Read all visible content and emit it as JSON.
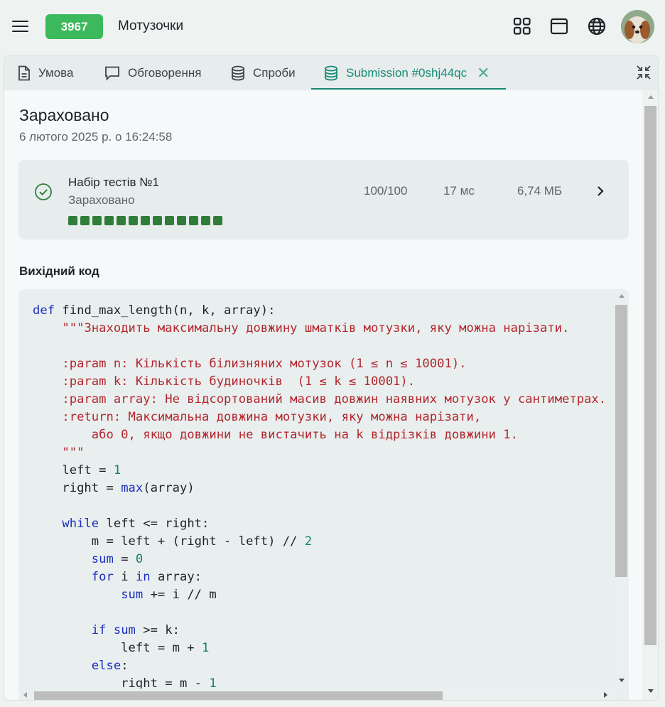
{
  "header": {
    "badge": "3967",
    "title": "Мотузочки",
    "icons": [
      "menu-icon",
      "apps-grid-icon",
      "window-icon",
      "globe-icon",
      "avatar"
    ]
  },
  "tabs": [
    {
      "label": "Умова",
      "icon": "document-icon"
    },
    {
      "label": "Обговорення",
      "icon": "chat-icon"
    },
    {
      "label": "Спроби",
      "icon": "database-icon"
    },
    {
      "label": "Submission #0shj44qc",
      "icon": "database-icon",
      "active": true
    }
  ],
  "submission": {
    "status": "Зараховано",
    "date": "6 лютого 2025 р. о 16:24:58"
  },
  "test_group": {
    "name": "Набір тестів №1",
    "status": "Зараховано",
    "score": "100/100",
    "time": "17 мс",
    "memory": "6,74 МБ",
    "passed_count": 13
  },
  "source": {
    "title": "Вихідний код",
    "lines": [
      "def find_max_length(n, k, array):",
      "    \"\"\"Знаходить максимальну довжину шматків мотузки, яку можна нарізати.",
      "",
      "    :param n: Кількість білизняних мотузок (1 ≤ n ≤ 10001).",
      "    :param k: Кількість будиночків  (1 ≤ k ≤ 10001).",
      "    :param array: Не відсортований масив довжин наявних мотузок у сантиметрах.",
      "    :return: Максимальна довжина мотузки, яку можна нарізати,",
      "        або 0, якщо довжини не вистачить на k відрізків довжини 1.",
      "    \"\"\"",
      "    left = 1",
      "    right = max(array)",
      "",
      "    while left <= right:",
      "        m = left + (right - left) // 2",
      "        sum = 0",
      "        for i in array:",
      "            sum += i // m",
      "",
      "        if sum >= k:",
      "            left = m + 1",
      "        else:",
      "            right = m - 1"
    ]
  },
  "colors": {
    "accent": "#1a8a76",
    "badge": "#3cb95c",
    "passed": "#2f7d39",
    "keyword": "#1a2fc0",
    "string": "#b3262e",
    "number": "#138266"
  }
}
